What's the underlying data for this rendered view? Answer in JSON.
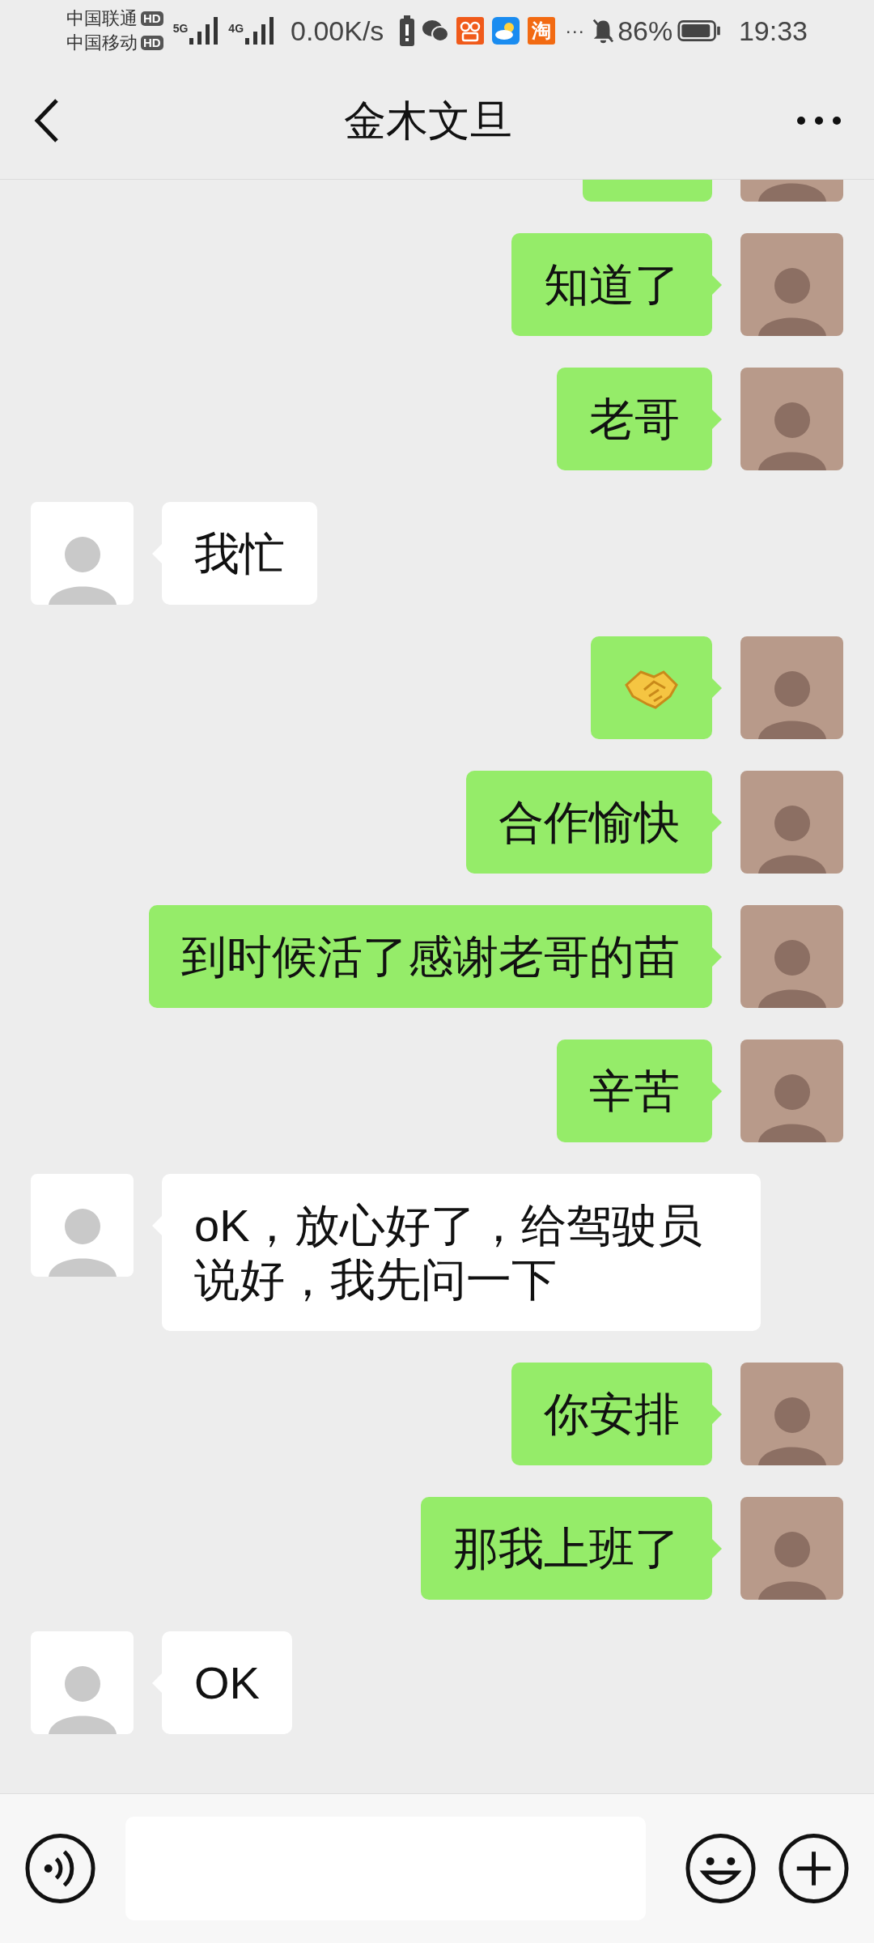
{
  "status_bar": {
    "carriers": [
      {
        "name": "中国联通",
        "badge": "HD"
      },
      {
        "name": "中国移动",
        "badge": "HD"
      }
    ],
    "networks": [
      {
        "label": "5G"
      },
      {
        "label": "4G"
      }
    ],
    "speed": "0.00K/s",
    "app_icons": [
      {
        "kind": "battery-alert"
      },
      {
        "kind": "wechat"
      },
      {
        "kind": "orange-app"
      },
      {
        "kind": "weather"
      },
      {
        "kind": "letter",
        "text": "淘"
      }
    ],
    "more": "···",
    "battery": "86%",
    "time": "19:33"
  },
  "header": {
    "title": "金木文旦"
  },
  "messages": [
    {
      "outgoing": true,
      "kind": "partial"
    },
    {
      "outgoing": true,
      "kind": "text",
      "text": "知道了"
    },
    {
      "outgoing": true,
      "kind": "text",
      "text": "老哥"
    },
    {
      "outgoing": false,
      "kind": "text",
      "text": "我忙"
    },
    {
      "outgoing": true,
      "kind": "handshake"
    },
    {
      "outgoing": true,
      "kind": "text",
      "text": "合作愉快"
    },
    {
      "outgoing": true,
      "kind": "text",
      "text": "到时候活了感谢老哥的苗"
    },
    {
      "outgoing": true,
      "kind": "text",
      "text": "辛苦"
    },
    {
      "outgoing": false,
      "kind": "text",
      "text": "oK，放心好了，给驾驶员说好，我先问一下"
    },
    {
      "outgoing": true,
      "kind": "text",
      "text": "你安排"
    },
    {
      "outgoing": true,
      "kind": "text",
      "text": "那我上班了"
    },
    {
      "outgoing": false,
      "kind": "text",
      "text": "OK"
    }
  ]
}
